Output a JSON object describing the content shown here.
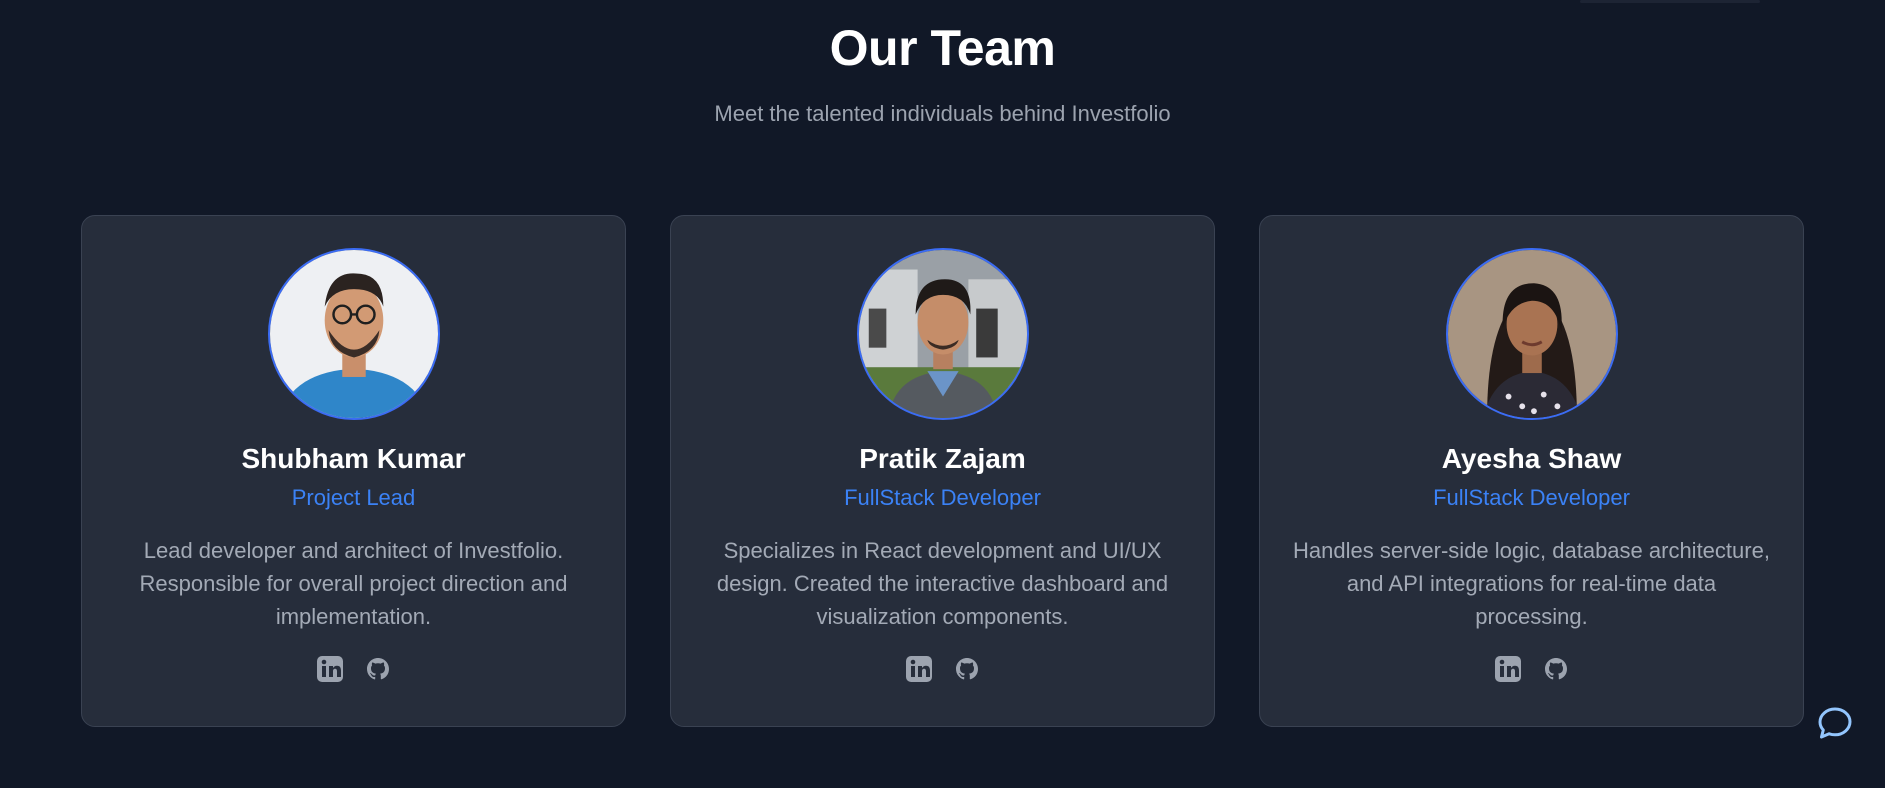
{
  "section": {
    "title": "Our Team",
    "subtitle": "Meet the talented individuals behind Investfolio"
  },
  "team": [
    {
      "name": "Shubham Kumar",
      "role": "Project Lead",
      "bio": "Lead developer and architect of Investfolio. Responsible for overall project direction and implementation.",
      "social": [
        "linkedin-icon",
        "github-icon"
      ]
    },
    {
      "name": "Pratik Zajam",
      "role": "FullStack Developer",
      "bio": "Specializes in React development and UI/UX design. Created the interactive dashboard and visualization components.",
      "social": [
        "linkedin-icon",
        "github-icon"
      ]
    },
    {
      "name": "Ayesha Shaw",
      "role": "FullStack Developer",
      "bio": "Handles server-side logic, database architecture, and API integrations for real-time data processing.",
      "social": [
        "linkedin-icon",
        "github-icon"
      ]
    }
  ],
  "colors": {
    "background": "#111827",
    "card": "#262d3b",
    "accent": "#3b82f6",
    "muted": "#9ca3af"
  },
  "chat_widget": {
    "icon": "chat-bubble-icon"
  }
}
